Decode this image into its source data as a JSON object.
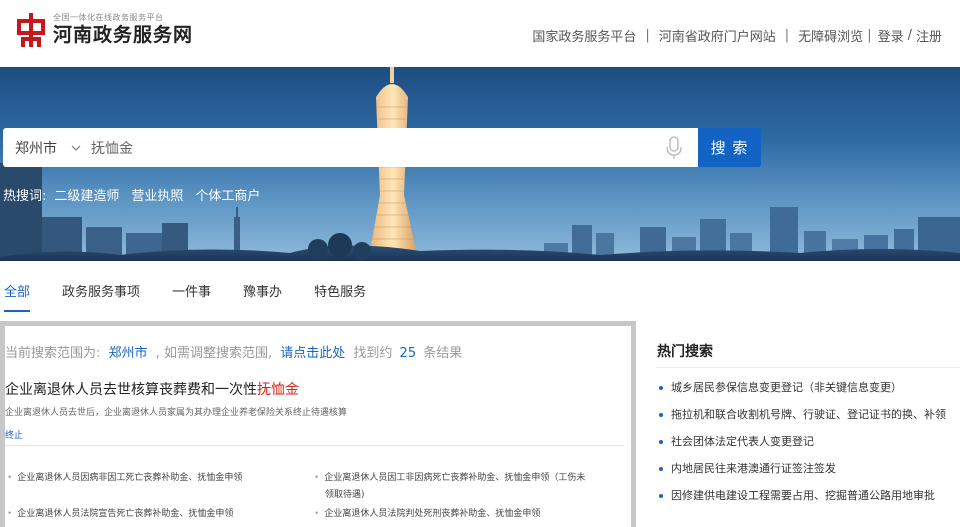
{
  "header": {
    "logo_sub": "全国一体化在线政务服务平台",
    "logo_title": "河南政务服务网",
    "nav": {
      "national": "国家政务服务平台",
      "provincial": "河南省政府门户网站",
      "accessible": "无障碍浏览",
      "login": "登录",
      "slash": "/",
      "register": "注册",
      "sep": "|"
    }
  },
  "search": {
    "city": "郑州市",
    "value": "抚恤金",
    "button": "搜 索",
    "hot_label": "热搜词:",
    "hot_words": [
      "二级建造师",
      "营业执照",
      "个体工商户"
    ]
  },
  "tabs": [
    "全部",
    "政务服务事项",
    "一件事",
    "豫事办",
    "特色服务"
  ],
  "result": {
    "scope_prefix": "当前搜索范围为:",
    "scope_city": "郑州市",
    "scope_mid": ",  如需调整搜索范围,",
    "scope_click": "请点击此处",
    "scope_found": "找到约",
    "scope_count": "25",
    "scope_suffix": "条结果",
    "title_main": "企业离退休人员去世核算丧葬费和一次性",
    "title_highlight": "抚恤金",
    "desc": "企业离退休人员去世后，企业离退休人员家属为其办理企业养老保险关系终止待遇核算",
    "tag": "终止",
    "sub_items": [
      {
        "text": "企业离退休人员因病非因工死亡丧葬补助金、抚恤金申领"
      },
      {
        "text": "企业离退休人员因工非因病死亡丧葬补助金、抚恤金申领（工伤未"
      },
      {
        "text": "领取待遇)"
      },
      {
        "text": "企业离退休人员法院宣告死亡丧葬补助金、抚恤金申领"
      },
      {
        "text": "企业离退休人员法院判处死刑丧葬补助金、抚恤金申领"
      }
    ],
    "bullet": "•"
  },
  "hot_search": {
    "title": "热门搜索",
    "items": [
      "城乡居民参保信息变更登记（非关键信息变更）",
      "拖拉机和联合收割机号牌、行驶证、登记证书的换、补领",
      "社会团体法定代表人变更登记",
      "内地居民往来港澳通行证签注签发",
      "因修建供电建设工程需要占用、挖掘普通公路用地审批"
    ]
  },
  "colors": {
    "accent": "#1766c3",
    "search_button": "#1363c4",
    "highlight": "#d9231c",
    "logo": "#c8161d",
    "frame": "#c7c7c7"
  },
  "icons": {
    "logo": "henan-gov-logo-icon",
    "city_dropdown": "chevron-down-icon",
    "voice": "microphone-icon"
  }
}
